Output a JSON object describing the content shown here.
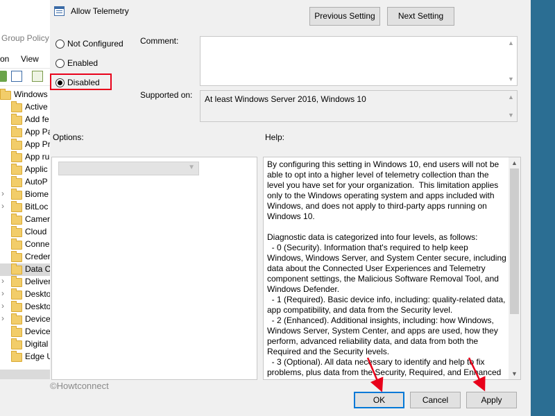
{
  "background_window": {
    "title": "Group Policy E",
    "menu": [
      "on",
      "View"
    ],
    "tree_items": [
      {
        "label": "Windows",
        "indent": 0,
        "expander": ""
      },
      {
        "label": "Active",
        "indent": 1,
        "expander": ""
      },
      {
        "label": "Add fe",
        "indent": 1,
        "expander": ""
      },
      {
        "label": "App Pa",
        "indent": 1,
        "expander": ""
      },
      {
        "label": "App Pr",
        "indent": 1,
        "expander": ""
      },
      {
        "label": "App ru",
        "indent": 1,
        "expander": ""
      },
      {
        "label": "Applic",
        "indent": 1,
        "expander": ""
      },
      {
        "label": "AutoP",
        "indent": 1,
        "expander": ""
      },
      {
        "label": "Biome",
        "indent": 1,
        "expander": "›"
      },
      {
        "label": "BitLoc",
        "indent": 1,
        "expander": "›"
      },
      {
        "label": "Camer",
        "indent": 1,
        "expander": ""
      },
      {
        "label": "Cloud",
        "indent": 1,
        "expander": ""
      },
      {
        "label": "Conne",
        "indent": 1,
        "expander": ""
      },
      {
        "label": "Creder",
        "indent": 1,
        "expander": ""
      },
      {
        "label": "Data C",
        "indent": 1,
        "expander": "",
        "selected": true
      },
      {
        "label": "Deliver",
        "indent": 1,
        "expander": "›"
      },
      {
        "label": "Deskto",
        "indent": 1,
        "expander": "›"
      },
      {
        "label": "Deskto",
        "indent": 1,
        "expander": "›"
      },
      {
        "label": "Device",
        "indent": 1,
        "expander": "›"
      },
      {
        "label": "Device",
        "indent": 1,
        "expander": ""
      },
      {
        "label": "Digital",
        "indent": 1,
        "expander": ""
      },
      {
        "label": "Edge U",
        "indent": 1,
        "expander": ""
      }
    ]
  },
  "dialog": {
    "title": "Allow Telemetry",
    "buttons": {
      "previous": "Previous Setting",
      "next": "Next Setting",
      "ok": "OK",
      "cancel": "Cancel",
      "apply": "Apply"
    },
    "state_options": [
      {
        "label": "Not Configured",
        "checked": false
      },
      {
        "label": "Enabled",
        "checked": false
      },
      {
        "label": "Disabled",
        "checked": true
      }
    ],
    "comment_label": "Comment:",
    "comment_value": "",
    "supported_label": "Supported on:",
    "supported_value": "At least Windows Server 2016, Windows 10",
    "options_label": "Options:",
    "help_label": "Help:",
    "help_text": "By configuring this setting in Windows 10, end users will not be able to opt into a higher level of telemetry collection than the level you have set for your organization.  This limitation applies only to the Windows operating system and apps included with Windows, and does not apply to third-party apps running on Windows 10.\n\nDiagnostic data is categorized into four levels, as follows:\n  - 0 (Security). Information that's required to help keep Windows, Windows Server, and System Center secure, including data about the Connected User Experiences and Telemetry component settings, the Malicious Software Removal Tool, and Windows Defender.\n  - 1 (Required). Basic device info, including: quality-related data, app compatibility, and data from the Security level.\n  - 2 (Enhanced). Additional insights, including: how Windows, Windows Server, System Center, and apps are used, how they perform, advanced reliability data, and data from both the Required and the Security levels.\n  - 3 (Optional). All data necessary to identify and help to fix problems, plus data from the Security, Required, and Enhanced levels."
  },
  "watermark": "©Howtconnect",
  "colors": {
    "highlight_red": "#e8001a",
    "default_button_border": "#0078d7",
    "desktop": "#2b6e93"
  },
  "icons": [
    "properties-icon",
    "radio-icon",
    "folder-icon",
    "chevron-right-icon",
    "dropdown-arrow-icon",
    "scroll-up-icon",
    "scroll-down-icon"
  ]
}
